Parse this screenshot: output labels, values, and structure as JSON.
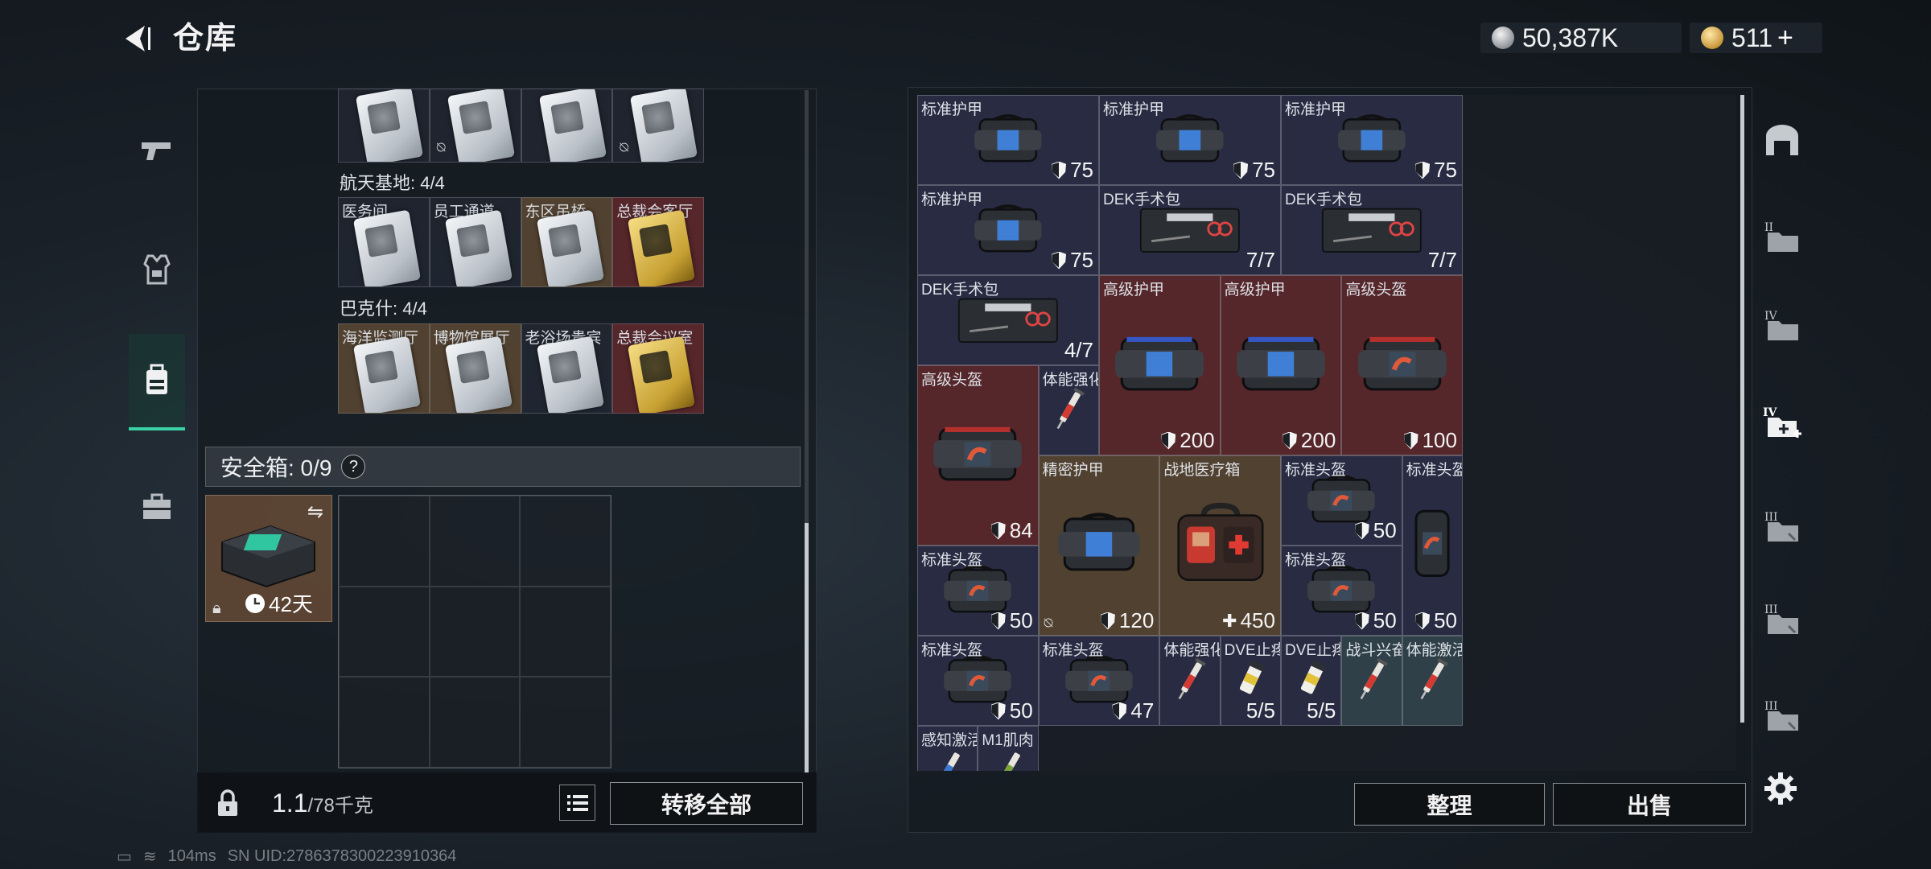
{
  "header": {
    "title": "仓库",
    "currency_silver": "50,387K",
    "currency_gold": "511",
    "gold_plus": "+"
  },
  "left_tabs": [
    "weapon-tab",
    "armor-tab",
    "backpack-tab",
    "toolbox-tab"
  ],
  "keycards": {
    "row0": [
      {
        "exit": false
      },
      {
        "exit": true
      },
      {
        "exit": false
      },
      {
        "exit": true
      }
    ],
    "group1": {
      "title": "航天基地: 4/4",
      "cards": [
        {
          "label": "医务间",
          "style": "blue"
        },
        {
          "label": "员工通道",
          "style": "blue"
        },
        {
          "label": "东区吊桥",
          "style": "gold"
        },
        {
          "label": "总裁会客厅",
          "style": "red"
        }
      ]
    },
    "group2": {
      "title": "巴克什: 4/4",
      "cards": [
        {
          "label": "海洋监测厅",
          "style": "gold"
        },
        {
          "label": "博物馆展厅",
          "style": "gold"
        },
        {
          "label": "老浴场贵宾",
          "style": "blue"
        },
        {
          "label": "总裁会议室",
          "style": "red"
        }
      ]
    }
  },
  "safe_box": {
    "label": "安全箱: 0/9",
    "help": "?",
    "item_days": "42天"
  },
  "bottom": {
    "weight_current": "1.1",
    "weight_max": "/78千克",
    "transfer_all": "转移全部"
  },
  "stash": {
    "items": [
      {
        "name": "标准护甲",
        "qty": "75",
        "shield": true,
        "style": "blue",
        "icon": "armor-bag",
        "col": 0,
        "row": 0,
        "w": 1.5,
        "h": 1
      },
      {
        "name": "标准护甲",
        "qty": "75",
        "shield": true,
        "style": "blue",
        "icon": "armor-bag",
        "col": 1.5,
        "row": 0,
        "w": 1.5,
        "h": 1
      },
      {
        "name": "标准护甲",
        "qty": "75",
        "shield": true,
        "style": "blue",
        "icon": "armor-bag",
        "col": 3,
        "row": 0,
        "w": 1.5,
        "h": 1
      },
      {
        "name": "标准护甲",
        "qty": "75",
        "shield": true,
        "style": "blue",
        "icon": "armor-bag",
        "col": 0,
        "row": 1,
        "w": 1.5,
        "h": 1
      },
      {
        "name": "DEK手术包",
        "qty": "7/7",
        "shield": false,
        "style": "blue",
        "icon": "surgery-kit",
        "col": 1.5,
        "row": 1,
        "w": 1.5,
        "h": 1
      },
      {
        "name": "DEK手术包",
        "qty": "7/7",
        "shield": false,
        "style": "blue",
        "icon": "surgery-kit",
        "col": 3,
        "row": 1,
        "w": 1.5,
        "h": 1
      },
      {
        "name": "DEK手术包",
        "qty": "4/7",
        "shield": false,
        "style": "blue",
        "icon": "surgery-kit",
        "col": 0,
        "row": 2,
        "w": 1.5,
        "h": 1
      },
      {
        "name": "高级护甲",
        "qty": "200",
        "shield": true,
        "style": "red",
        "icon": "armor-bag-blue",
        "col": 1.5,
        "row": 2,
        "w": 1,
        "h": 2
      },
      {
        "name": "高级护甲",
        "qty": "200",
        "shield": true,
        "style": "red",
        "icon": "armor-bag-blue",
        "col": 2.5,
        "row": 2,
        "w": 1,
        "h": 2
      },
      {
        "name": "高级头盔",
        "qty": "100",
        "shield": true,
        "style": "red",
        "icon": "helmet-bag-red",
        "col": 3.5,
        "row": 2,
        "w": 1,
        "h": 2
      },
      {
        "name": "高级头盔",
        "qty": "84",
        "shield": true,
        "style": "red",
        "icon": "helmet-bag-red",
        "col": 0,
        "row": 3,
        "w": 1,
        "h": 2
      },
      {
        "name": "体能强化剂",
        "qty": "",
        "shield": false,
        "style": "blue",
        "icon": "syringe-red",
        "col": 1,
        "row": 3,
        "w": 0.5,
        "h": 1
      },
      {
        "name": "精密护甲",
        "qty": "120",
        "shield": true,
        "exit": true,
        "style": "gold",
        "icon": "armor-bag",
        "col": 1,
        "row": 4,
        "w": 1,
        "h": 2
      },
      {
        "name": "战地医疗箱",
        "qty": "450",
        "plus": true,
        "style": "gold",
        "icon": "first-aid",
        "col": 2,
        "row": 4,
        "w": 1,
        "h": 2
      },
      {
        "name": "标准头盔",
        "qty": "50",
        "shield": true,
        "style": "blue",
        "icon": "helmet-bag",
        "col": 3,
        "row": 4,
        "w": 1,
        "h": 1
      },
      {
        "name": "标准头盔",
        "qty": "50",
        "shield": true,
        "style": "blue",
        "icon": "helmet-bag-vertical",
        "col": 4,
        "row": 4,
        "w": 0.5,
        "h": 2
      },
      {
        "name": "标准头盔",
        "qty": "50",
        "shield": true,
        "style": "blue",
        "icon": "helmet-bag",
        "col": 0,
        "row": 5,
        "w": 1,
        "h": 1
      },
      {
        "name": "标准头盔",
        "qty": "50",
        "shield": true,
        "style": "blue",
        "icon": "helmet-bag",
        "col": 3,
        "row": 5,
        "w": 1,
        "h": 1
      },
      {
        "name": "标准头盔",
        "qty": "50",
        "shield": true,
        "style": "blue",
        "icon": "helmet-bag",
        "col": 0,
        "row": 6,
        "w": 1,
        "h": 1
      },
      {
        "name": "标准头盔",
        "qty": "47",
        "shield": true,
        "style": "blue",
        "icon": "helmet-bag",
        "col": 1,
        "row": 6,
        "w": 1,
        "h": 1
      },
      {
        "name": "体能强化剂",
        "qty": "",
        "shield": false,
        "style": "blue",
        "icon": "syringe-red",
        "col": 2,
        "row": 6,
        "w": 0.5,
        "h": 1
      },
      {
        "name": "DVE止疼片",
        "qty": "5/5",
        "shield": false,
        "style": "blue",
        "icon": "pill-bottle",
        "col": 2.5,
        "row": 6,
        "w": 0.5,
        "h": 1
      },
      {
        "name": "DVE止疼片",
        "qty": "5/5",
        "shield": false,
        "style": "blue",
        "icon": "pill-bottle",
        "col": 3,
        "row": 6,
        "w": 0.5,
        "h": 1
      },
      {
        "name": "战斗兴奋剂",
        "qty": "",
        "shield": false,
        "style": "teal",
        "icon": "syringe-red",
        "col": 3.5,
        "row": 6,
        "w": 0.5,
        "h": 1
      },
      {
        "name": "体能激活针",
        "qty": "",
        "shield": false,
        "style": "teal",
        "icon": "syringe-red",
        "col": 4,
        "row": 6,
        "w": 0.5,
        "h": 1
      },
      {
        "name": "感知激活针",
        "qty": "",
        "shield": false,
        "style": "blue",
        "icon": "syringe-blue",
        "col": 0,
        "row": 7,
        "w": 0.5,
        "h": 1
      },
      {
        "name": "M1肌肉",
        "qty": "",
        "shield": false,
        "style": "blue",
        "icon": "syringe-green",
        "col": 0.5,
        "row": 7,
        "w": 0.5,
        "h": 1
      }
    ],
    "sort_label": "整理",
    "sell_label": "出售"
  },
  "right_tabs": [
    "safehouse-tab",
    "stash-tab-2",
    "stash-tab-4",
    "stash-tab-add",
    "stash-tab-3",
    "stash-tab-3b",
    "stash-tab-6"
  ],
  "status_bar": {
    "fps": "104ms",
    "uid": "SN UID:2786378300223910364"
  },
  "colors": {
    "accent": "#3ad1a4",
    "blue_slot": "#2b2e48",
    "red_slot": "#60282c",
    "gold_slot": "#5c4832"
  }
}
